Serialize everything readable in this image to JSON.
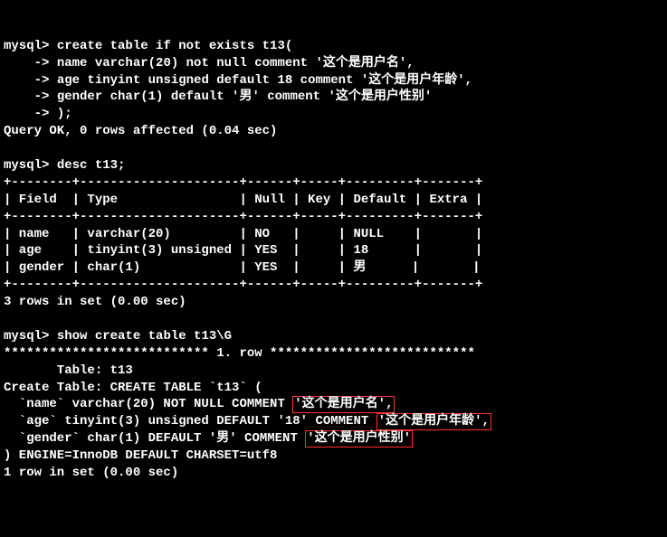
{
  "prompt": "mysql>",
  "cont": "    ->",
  "create": {
    "l1": " create table if not exists t13(",
    "l2": " name varchar(20) not null comment '这个是用户名',",
    "l3": " age tinyint unsigned default 18 comment '这个是用户年龄',",
    "l4": " gender char(1) default '男' comment '这个是用户性别'",
    "l5": " );"
  },
  "result1": "Query OK, 0 rows affected (0.04 sec)",
  "desc_cmd": " desc t13;",
  "table": {
    "border": "+--------+---------------------+------+-----+---------+-------+",
    "header": "| Field  | Type                | Null | Key | Default | Extra |",
    "rows": [
      "| name   | varchar(20)         | NO   |     | NULL    |       |",
      "| age    | tinyint(3) unsigned | YES  |     | 18      |       |",
      "| gender | char(1)             | YES  |     | 男      |       |"
    ]
  },
  "result2": "3 rows in set (0.00 sec)",
  "show_cmd": " show create table t13\\G",
  "row_header": "*************************** 1. row ***************************",
  "show": {
    "t1": "       Table: t13",
    "t2": "Create Table: CREATE TABLE `t13` (",
    "name_pre": "  `name` varchar(20) NOT NULL COMMENT ",
    "name_hl": "'这个是用户名',",
    "age_pre": "  `age` tinyint(3) unsigned DEFAULT '18' COMMENT ",
    "age_hl": "'这个是用户年龄',",
    "gender_pre": "  `gender` char(1) DEFAULT '男' COMMENT ",
    "gender_hl": "'这个是用户性别'",
    "t6": ") ENGINE=InnoDB DEFAULT CHARSET=utf8"
  },
  "result3": "1 row in set (0.00 sec)",
  "chart_data": {
    "type": "table",
    "title": "desc t13",
    "columns": [
      "Field",
      "Type",
      "Null",
      "Key",
      "Default",
      "Extra"
    ],
    "rows": [
      [
        "name",
        "varchar(20)",
        "NO",
        "",
        "NULL",
        ""
      ],
      [
        "age",
        "tinyint(3) unsigned",
        "YES",
        "",
        "18",
        ""
      ],
      [
        "gender",
        "char(1)",
        "YES",
        "",
        "男",
        ""
      ]
    ]
  }
}
